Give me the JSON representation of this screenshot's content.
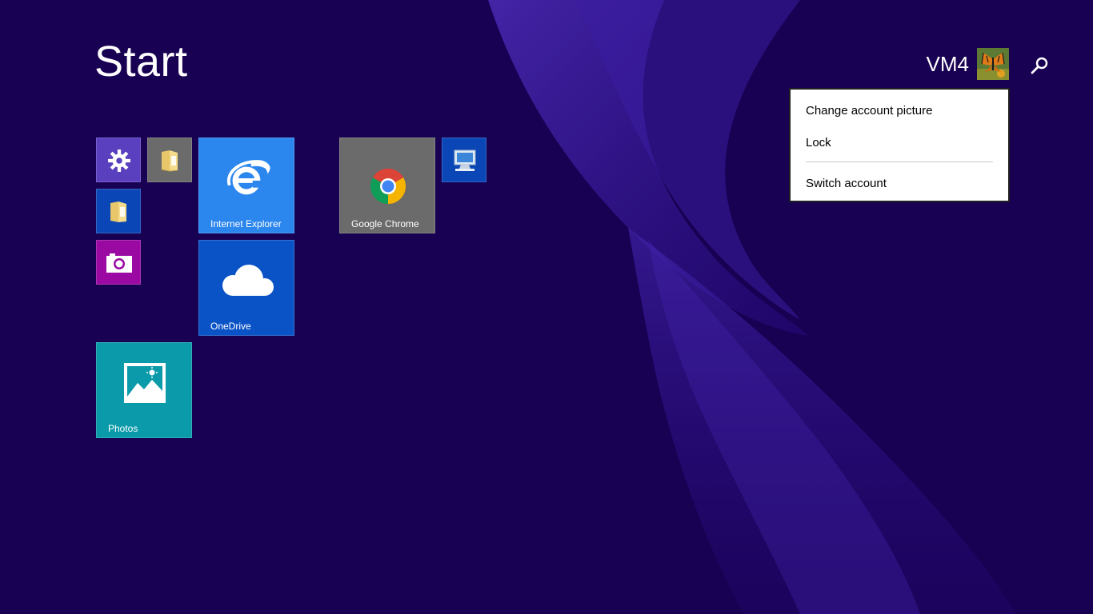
{
  "screen": {
    "title": "Start"
  },
  "account": {
    "user_name": "VM4",
    "avatar_icon": "butterfly-avatar-icon"
  },
  "search": {
    "icon": "search-icon"
  },
  "tiles": {
    "settings": {
      "icon": "gear-icon",
      "color": "#5a3fbf"
    },
    "explorer_top": {
      "icon": "folder-icon",
      "color": "#6b6b6b"
    },
    "explorer_left": {
      "icon": "folder-icon",
      "color": "#0a46b5"
    },
    "camera": {
      "icon": "camera-icon",
      "color": "#9a0aa3"
    },
    "internet_explorer": {
      "label": "Internet Explorer",
      "icon": "ie-logo-icon",
      "color": "#2b86ee"
    },
    "onedrive": {
      "label": "OneDrive",
      "icon": "cloud-icon",
      "color": "#0a53c7"
    },
    "google_chrome": {
      "label": "Google Chrome",
      "icon": "chrome-logo-icon",
      "color": "#6b6b6b"
    },
    "this_pc": {
      "icon": "computer-monitor-icon",
      "color": "#0a46b5"
    },
    "photos": {
      "label": "Photos",
      "icon": "photo-landscape-icon",
      "color": "#0a9aa9"
    }
  },
  "account_menu": {
    "items": [
      "Change account picture",
      "Lock",
      "Switch account"
    ]
  }
}
